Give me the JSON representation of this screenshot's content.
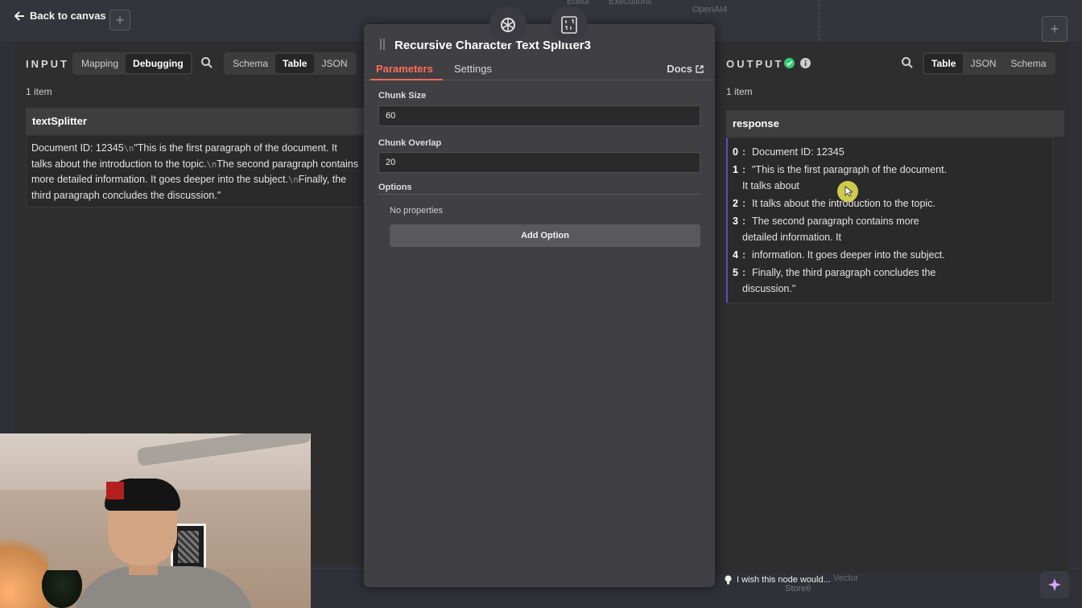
{
  "app": {
    "back_label": "Back to canvas",
    "bg_tabs": [
      "Editor",
      "Executions"
    ],
    "bg_node_top": "OpenAI4",
    "bg_node_bottom": "Store6",
    "bg_node_bottom_right": "Vector",
    "wish_text": "I wish this node would..."
  },
  "input": {
    "label": "INPUT",
    "mode_tabs": [
      "Mapping",
      "Debugging"
    ],
    "view_tabs": [
      "Schema",
      "Table",
      "JSON"
    ],
    "count": "1 item",
    "column": "textSplitter",
    "cell_parts": [
      "Document ID: 12345",
      "\\n",
      "\"This is the first paragraph of the document. It talks about the introduction to the topic.",
      "\\n",
      "The second paragraph contains more detailed information. It goes deeper into the subject.",
      "\\n",
      "Finally, the third paragraph concludes the discussion.\""
    ]
  },
  "node": {
    "title": "Recursive Character Text Splitter3",
    "tabs": [
      "Parameters",
      "Settings"
    ],
    "docs_label": "Docs",
    "chunk_size_label": "Chunk Size",
    "chunk_size_value": "60",
    "chunk_overlap_label": "Chunk Overlap",
    "chunk_overlap_value": "20",
    "options_label": "Options",
    "no_properties": "No properties",
    "add_option_label": "Add Option"
  },
  "output": {
    "label": "OUTPUT",
    "view_tabs": [
      "Table",
      "JSON",
      "Schema"
    ],
    "count": "1 item",
    "column": "response",
    "rows": [
      {
        "idx": "0",
        "lines": [
          "Document ID: 12345"
        ]
      },
      {
        "idx": "1",
        "lines": [
          "\"This is the first paragraph of the document.",
          "It talks about"
        ]
      },
      {
        "idx": "2",
        "lines": [
          "It talks about the introduction to the topic."
        ]
      },
      {
        "idx": "3",
        "lines": [
          "The second paragraph contains more",
          "detailed information. It"
        ]
      },
      {
        "idx": "4",
        "lines": [
          "information. It goes deeper into the subject."
        ]
      },
      {
        "idx": "5",
        "lines": [
          "Finally, the third paragraph concludes the",
          "discussion.\""
        ]
      }
    ]
  },
  "colors": {
    "accent": "#ff6d5a",
    "success": "#2ecc71",
    "panel": "#2e2e2e"
  }
}
